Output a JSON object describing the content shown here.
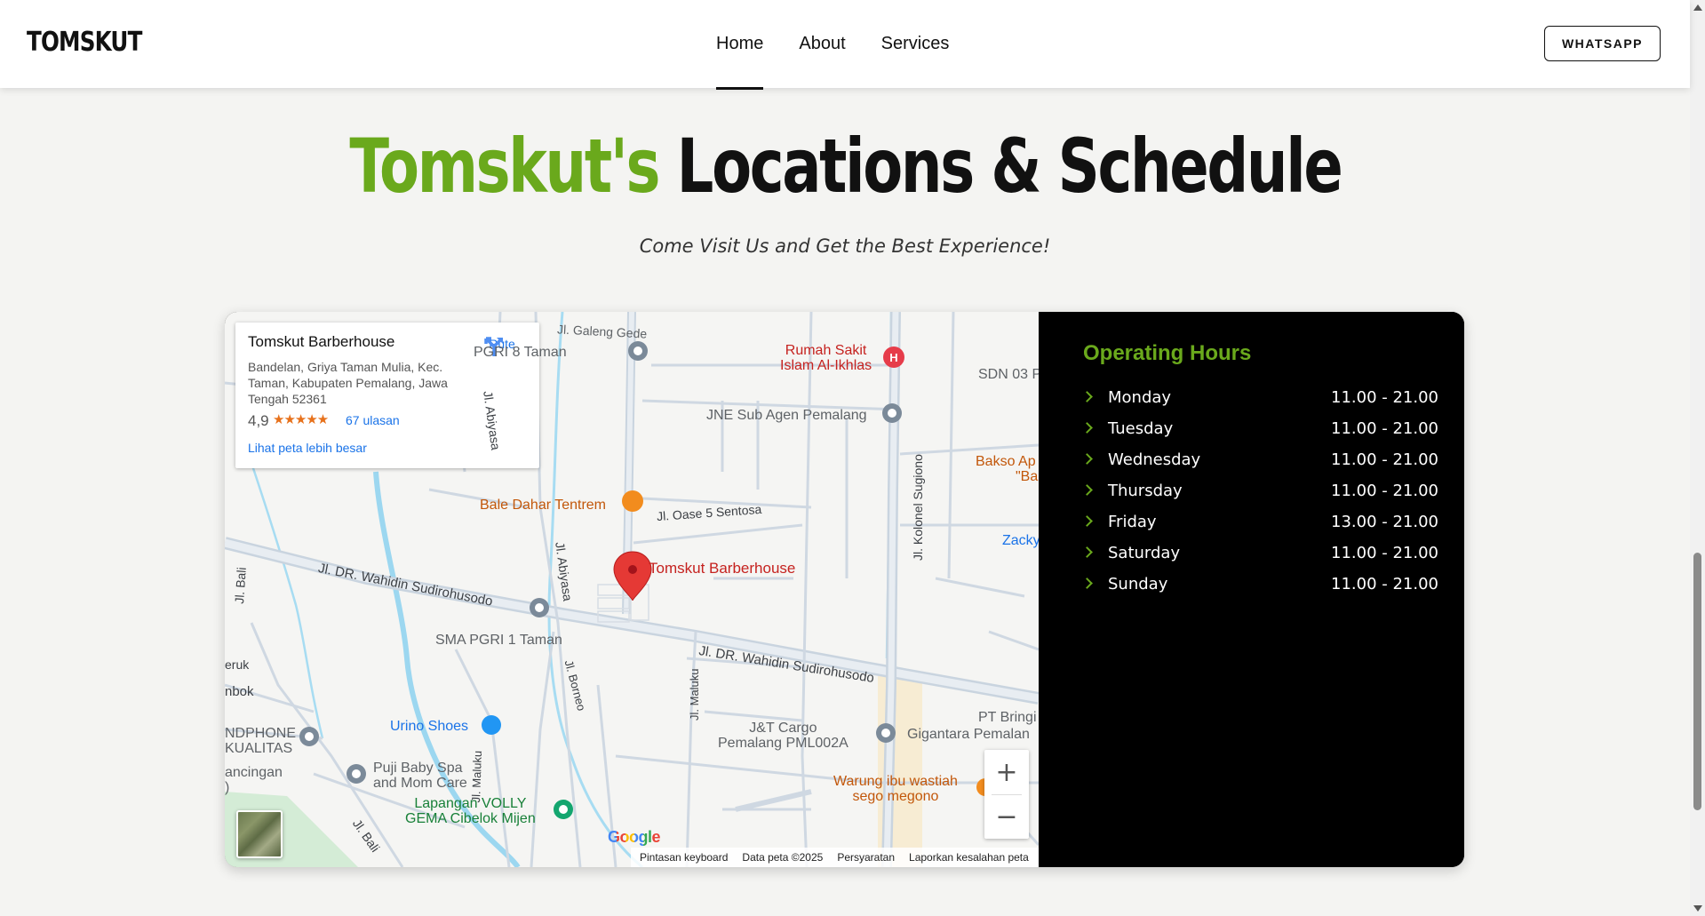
{
  "header": {
    "logo": "TOMSKUT",
    "nav": [
      "Home",
      "About",
      "Services"
    ],
    "whatsapp_label": "WHATSAPP"
  },
  "section": {
    "title_highlight": "Tomskut's",
    "title_rest": "Locations & Schedule",
    "subtitle": "Come Visit Us and Get the Best Experience!"
  },
  "map": {
    "place": {
      "name": "Tomskut Barberhouse",
      "address": "Bandelan, Griya Taman Mulia, Kec. Taman, Kabupaten Pemalang, Jawa Tengah 52361",
      "rating": "4,9",
      "stars": "★★★★★",
      "reviews": "67 ulasan",
      "larger_map": "Lihat peta lebih besar",
      "route": "Rute"
    },
    "pin_label": "Tomskut Barberhouse",
    "labels": {
      "galeng": "Jl. Galeng Gede",
      "pgri8": "PGRI 8 Taman",
      "rs_line1": "Rumah Sakit",
      "rs_line2": "Islam Al-Ikhlas",
      "sdn": "SDN 03 P",
      "jne": "JNE Sub Agen Pemalang",
      "abiyasa1": "Jl. Abiyasa",
      "kolonel": "Jl. Kolonel Sugiono",
      "bakso1": "Bakso Ap",
      "bakso2": "\"Ba",
      "bale": "Bale Dahar Tentrem",
      "oase": "Jl. Oase 5 Sentosa",
      "zacky": "Zacky",
      "bali1": "Jl. Bali",
      "wahidin1": "Jl. DR. Wahidin Sudirohusodo",
      "abiyasa2": "Jl. Abiyasa",
      "sma": "SMA PGRI 1 Taman",
      "wahidin2": "Jl. DR. Wahidin Sudirohusodo",
      "eruk": "eruk",
      "nbok": "nbok",
      "borneo": "Jl. Borneo",
      "maluku1": "Jl. Maluku",
      "urino": "Urino Shoes",
      "ndphone1": "NDPHONE",
      "ndphone2": "KUALITAS",
      "jt1": "J&T Cargo",
      "jt2": "Pemalang PML002A",
      "gigantara": "Gigantara Pemalan",
      "ptbring": "PT Bringi",
      "maluku2": "Jl. Maluku",
      "ancingan1": "ancingan",
      "ancingan2": ")",
      "puji1": "Puji Baby Spa",
      "puji2": "and Mom Care",
      "warung1": "Warung ibu wastiah",
      "warung2": "sego megono",
      "volly1": "Lapangan VOLLY",
      "volly2": "GEMA Cibelok Mijen",
      "bali2": "Jl. Bali"
    },
    "google": "Google",
    "footer": [
      "Pintasan keyboard",
      "Data peta ©2025",
      "Persyaratan",
      "Laporkan kesalahan peta"
    ],
    "zoom_in": "+",
    "zoom_out": "−"
  },
  "hours": {
    "title": "Operating Hours",
    "rows": [
      {
        "day": "Monday",
        "time": "11.00 - 21.00"
      },
      {
        "day": "Tuesday",
        "time": "11.00 - 21.00"
      },
      {
        "day": "Wednesday",
        "time": "11.00 - 21.00"
      },
      {
        "day": "Thursday",
        "time": "11.00 - 21.00"
      },
      {
        "day": "Friday",
        "time": "13.00 - 21.00"
      },
      {
        "day": "Saturday",
        "time": "11.00 - 21.00"
      },
      {
        "day": "Sunday",
        "time": "11.00 - 21.00"
      }
    ]
  },
  "colors": {
    "accent_green": "#6aa91c",
    "map_water": "#9cd7f0",
    "map_road": "#c9d4df",
    "pin_red": "#e53935"
  }
}
